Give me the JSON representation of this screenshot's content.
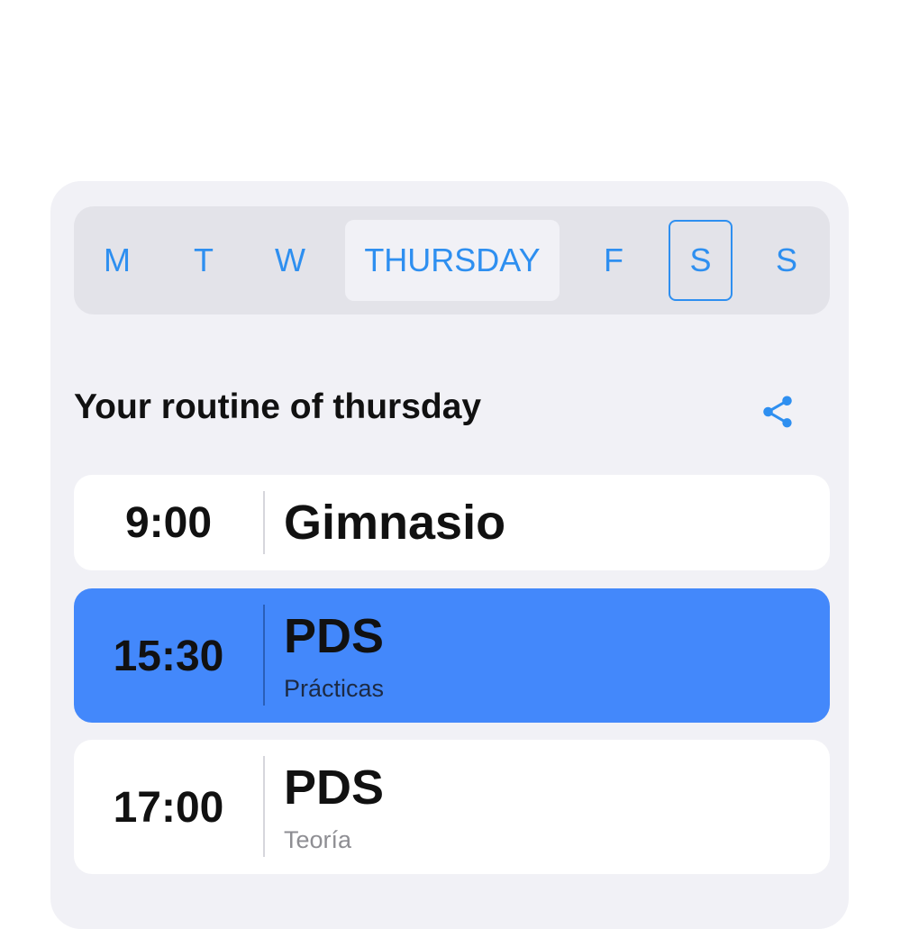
{
  "day_selector": {
    "days": [
      "M",
      "T",
      "W",
      "THURSDAY",
      "F",
      "S",
      "S"
    ],
    "selected": "THURSDAY"
  },
  "section": {
    "title": "Your routine of thursday",
    "share_icon": "share-icon"
  },
  "routine": [
    {
      "time": "9:00",
      "name": "Gimnasio",
      "detail": ""
    },
    {
      "time": "15:30",
      "name": "PDS",
      "detail": "Prácticas"
    },
    {
      "time": "17:00",
      "name": "PDS",
      "detail": "Teoría"
    }
  ],
  "colors": {
    "accent": "#2e8ff0",
    "highlight": "#4388fb",
    "card_background": "#f1f1f6",
    "selector_background": "#e3e3e9"
  }
}
